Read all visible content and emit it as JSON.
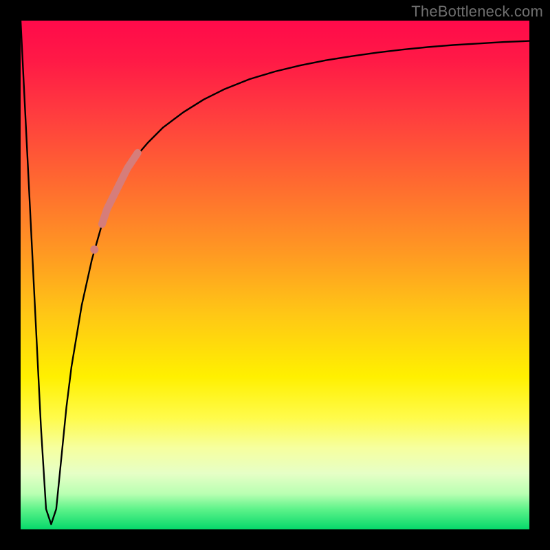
{
  "watermark": "TheBottleneck.com",
  "colors": {
    "frame": "#000000",
    "curve": "#000000",
    "highlight": "#d67d7a",
    "gradient_top": "#ff0a4a",
    "gradient_bottom": "#05d86a"
  },
  "chart_data": {
    "type": "line",
    "title": "",
    "xlabel": "",
    "ylabel": "",
    "xlim": [
      0,
      100
    ],
    "ylim": [
      0,
      100
    ],
    "grid": false,
    "legend": false,
    "annotations": [
      "TheBottleneck.com"
    ],
    "series": [
      {
        "name": "bottleneck-curve",
        "x": [
          0,
          1,
          2,
          3,
          4,
          5,
          6,
          7,
          8,
          9,
          10,
          12,
          14,
          16,
          18,
          20,
          22,
          25,
          28,
          32,
          36,
          40,
          45,
          50,
          55,
          60,
          65,
          70,
          75,
          80,
          85,
          90,
          95,
          100
        ],
        "y": [
          100,
          80,
          60,
          40,
          20,
          4,
          1,
          4,
          14,
          24,
          32,
          44,
          53,
          60,
          65,
          69,
          72.5,
          76,
          79,
          82,
          84.5,
          86.5,
          88.5,
          90,
          91.2,
          92.2,
          93,
          93.7,
          94.3,
          94.8,
          95.2,
          95.5,
          95.8,
          96
        ]
      },
      {
        "name": "highlight-segment",
        "x": [
          16,
          17,
          18,
          19,
          20,
          21,
          22,
          23
        ],
        "y": [
          60,
          63,
          65,
          67,
          69,
          71,
          72.5,
          74
        ]
      },
      {
        "name": "highlight-dot",
        "x": [
          14.5
        ],
        "y": [
          55
        ]
      }
    ]
  }
}
